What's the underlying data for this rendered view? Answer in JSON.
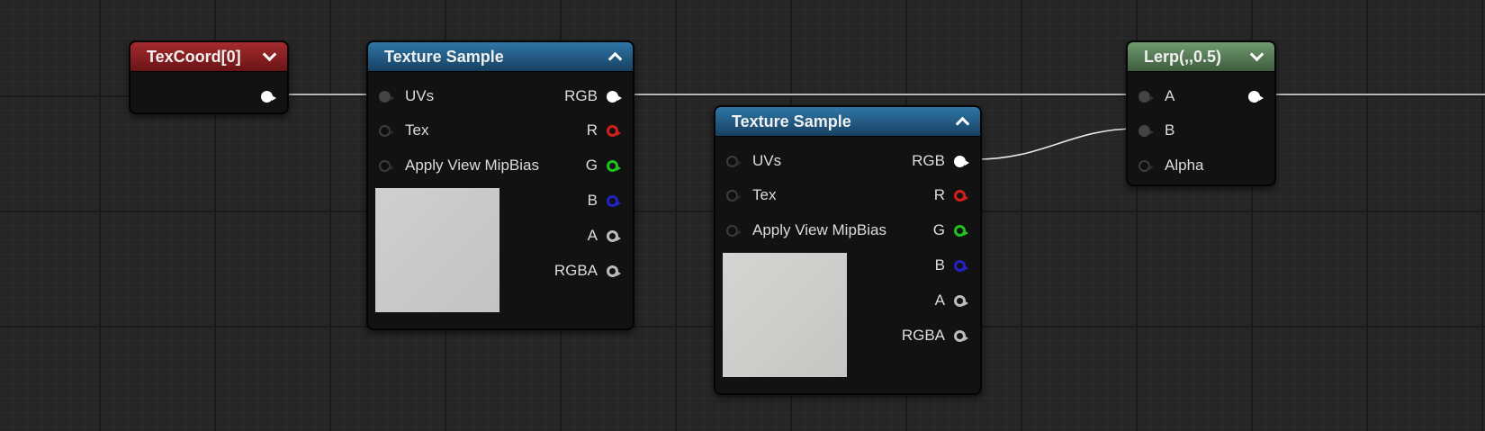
{
  "nodes": {
    "texcoord": {
      "title": "TexCoord[0]",
      "header_color": "#8b1f21"
    },
    "texsample1": {
      "title": "Texture Sample",
      "header_color": "#256390",
      "inputs": [
        "UVs",
        "Tex",
        "Apply View MipBias"
      ],
      "outputs": [
        "RGB",
        "R",
        "G",
        "B",
        "A",
        "RGBA"
      ],
      "preview_color": "#c8c8c8"
    },
    "texsample2": {
      "title": "Texture Sample",
      "header_color": "#256390",
      "inputs": [
        "UVs",
        "Tex",
        "Apply View MipBias"
      ],
      "outputs": [
        "RGB",
        "R",
        "G",
        "B",
        "A",
        "RGBA"
      ],
      "preview_color": "#cdcdcd"
    },
    "lerp": {
      "title": "Lerp(,,0.5)",
      "header_color": "#5c845c",
      "inputs": [
        "A",
        "B",
        "Alpha"
      ]
    }
  },
  "pin_colors": {
    "rgb": "#ffffff",
    "r": "#d41d1d",
    "g": "#1fc01f",
    "b": "#2222c6",
    "a": "#bbbbbb",
    "rgba": "#bbbbbb"
  },
  "wire_color": "#e6e6e6"
}
